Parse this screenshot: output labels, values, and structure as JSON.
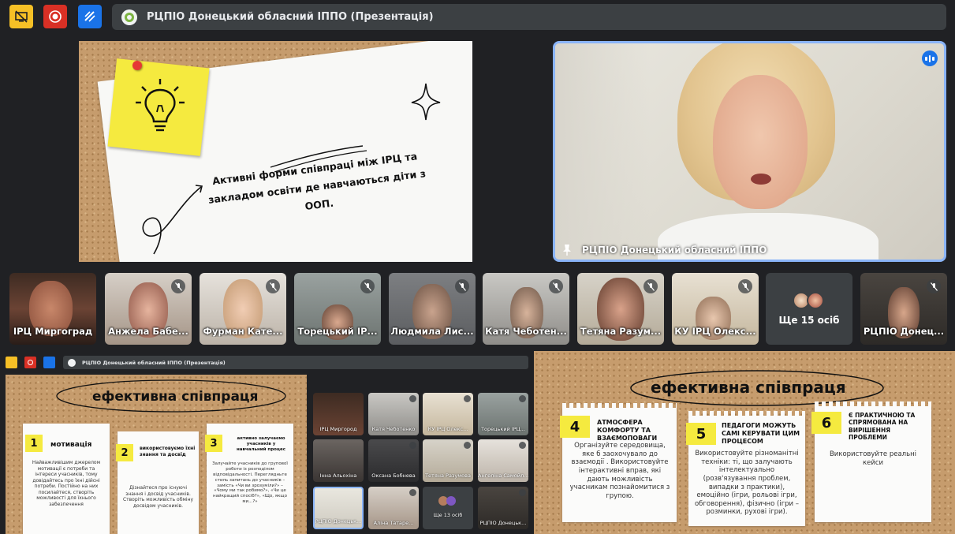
{
  "meeting": {
    "title": "РЦПІО Донецький обласний ІППО (Презентація)"
  },
  "slide_main": {
    "text": "Активні форми співпраці між ІРЦ та закладом освіти де навчаються діти з ООП."
  },
  "speaker": {
    "name": "РЦПІО Донецький обласний ІППО"
  },
  "participants": [
    {
      "name": "ІРЦ Миргоград",
      "muted": false
    },
    {
      "name": "Анжела Бабе...",
      "muted": true
    },
    {
      "name": "Фурман Кате...",
      "muted": true
    },
    {
      "name": "Торецький ІР...",
      "muted": true
    },
    {
      "name": "Людмила Лис...",
      "muted": true
    },
    {
      "name": "Катя Чеботен...",
      "muted": true
    },
    {
      "name": "Тетяна Разум...",
      "muted": true
    },
    {
      "name": "КУ ІРЦ Олекс...",
      "muted": true
    },
    {
      "name": "Ще 15 осіб",
      "muted": false
    },
    {
      "name": "РЦПІО Донец...",
      "muted": true
    }
  ],
  "mini": {
    "title": "РЦПІО Донецький обласний ІППО (Презентація)",
    "slide_title": "ефективна співпраця",
    "cards": [
      {
        "num": "1",
        "title": "мотивація",
        "text": "Найважливішим джерелом мотивації є потреби та інтереси учасників, тому довідайтесь про їхні дійсні потреби. Постійно на них посилайтеся, створіть можливості для їхнього забезпечення"
      },
      {
        "num": "2",
        "title": "використовуємо їхні знання та досвід",
        "text": "Дізнайтеся про існуючі знання і досвід учасників. Створіть можливість обміну досвідом учасників."
      },
      {
        "num": "3",
        "title": "активно залучаємо учасників у навчальний процес",
        "text": "Залучайте учасників до групової роботи із розподілом відповідальності. Переглядньте стиль запитань до учасників – замість «Чи ви зрозуміли?» – «Чому ми так робимо?», «Чи це найкращий спосіб?», «Що, якщо ми...?»"
      }
    ],
    "tiles": [
      {
        "name": "ІРЦ Миргород"
      },
      {
        "name": "Катя Чеботенко"
      },
      {
        "name": "КУ ІРЦ Олекс..."
      },
      {
        "name": "Торецький ІРЦ..."
      },
      {
        "name": "Інна Альохіна"
      },
      {
        "name": "Оксана Бобнева"
      },
      {
        "name": "Тетяна Разумова"
      },
      {
        "name": "Ангеліна Самойл..."
      },
      {
        "name": "РЦПІО Донецьк..."
      },
      {
        "name": "Аліна Татаре..."
      },
      {
        "name": "Ще 13 осіб"
      },
      {
        "name": "РЦПІО Донецьк..."
      }
    ]
  },
  "slide_right": {
    "title": "ефективна співпраця",
    "cards": [
      {
        "num": "4",
        "title": "атмосфера комфорту та взаємоповаги",
        "text": "Організуйте середовища, яке б заохочувало до взаємодії . Використовуйте інтерактивні вправ, які дають можливість учасникам познайомитися з групою."
      },
      {
        "num": "5",
        "title": "педагоги можуть самі керувати цим процесом",
        "text": "Використовуйте різноманітні техніки: ті, що залучають інтелектуально (розв'язування проблем, випадки з практики), емоційно (ігри, рольові ігри, обговорення), фізично (ігри – розминки, рухові ігри)."
      },
      {
        "num": "6",
        "title": "є практичною та спрямована на вирішення проблеми",
        "text": "Використовуйте реальні кейси"
      }
    ]
  },
  "colors": {
    "background": "#202124",
    "titlebar": "#3c4043",
    "active_speaker_border": "#8ab4f8",
    "btn_yellow": "#f6c026",
    "btn_red": "#d93025",
    "btn_blue": "#1a73e8",
    "sticky": "#f5ea3f"
  }
}
